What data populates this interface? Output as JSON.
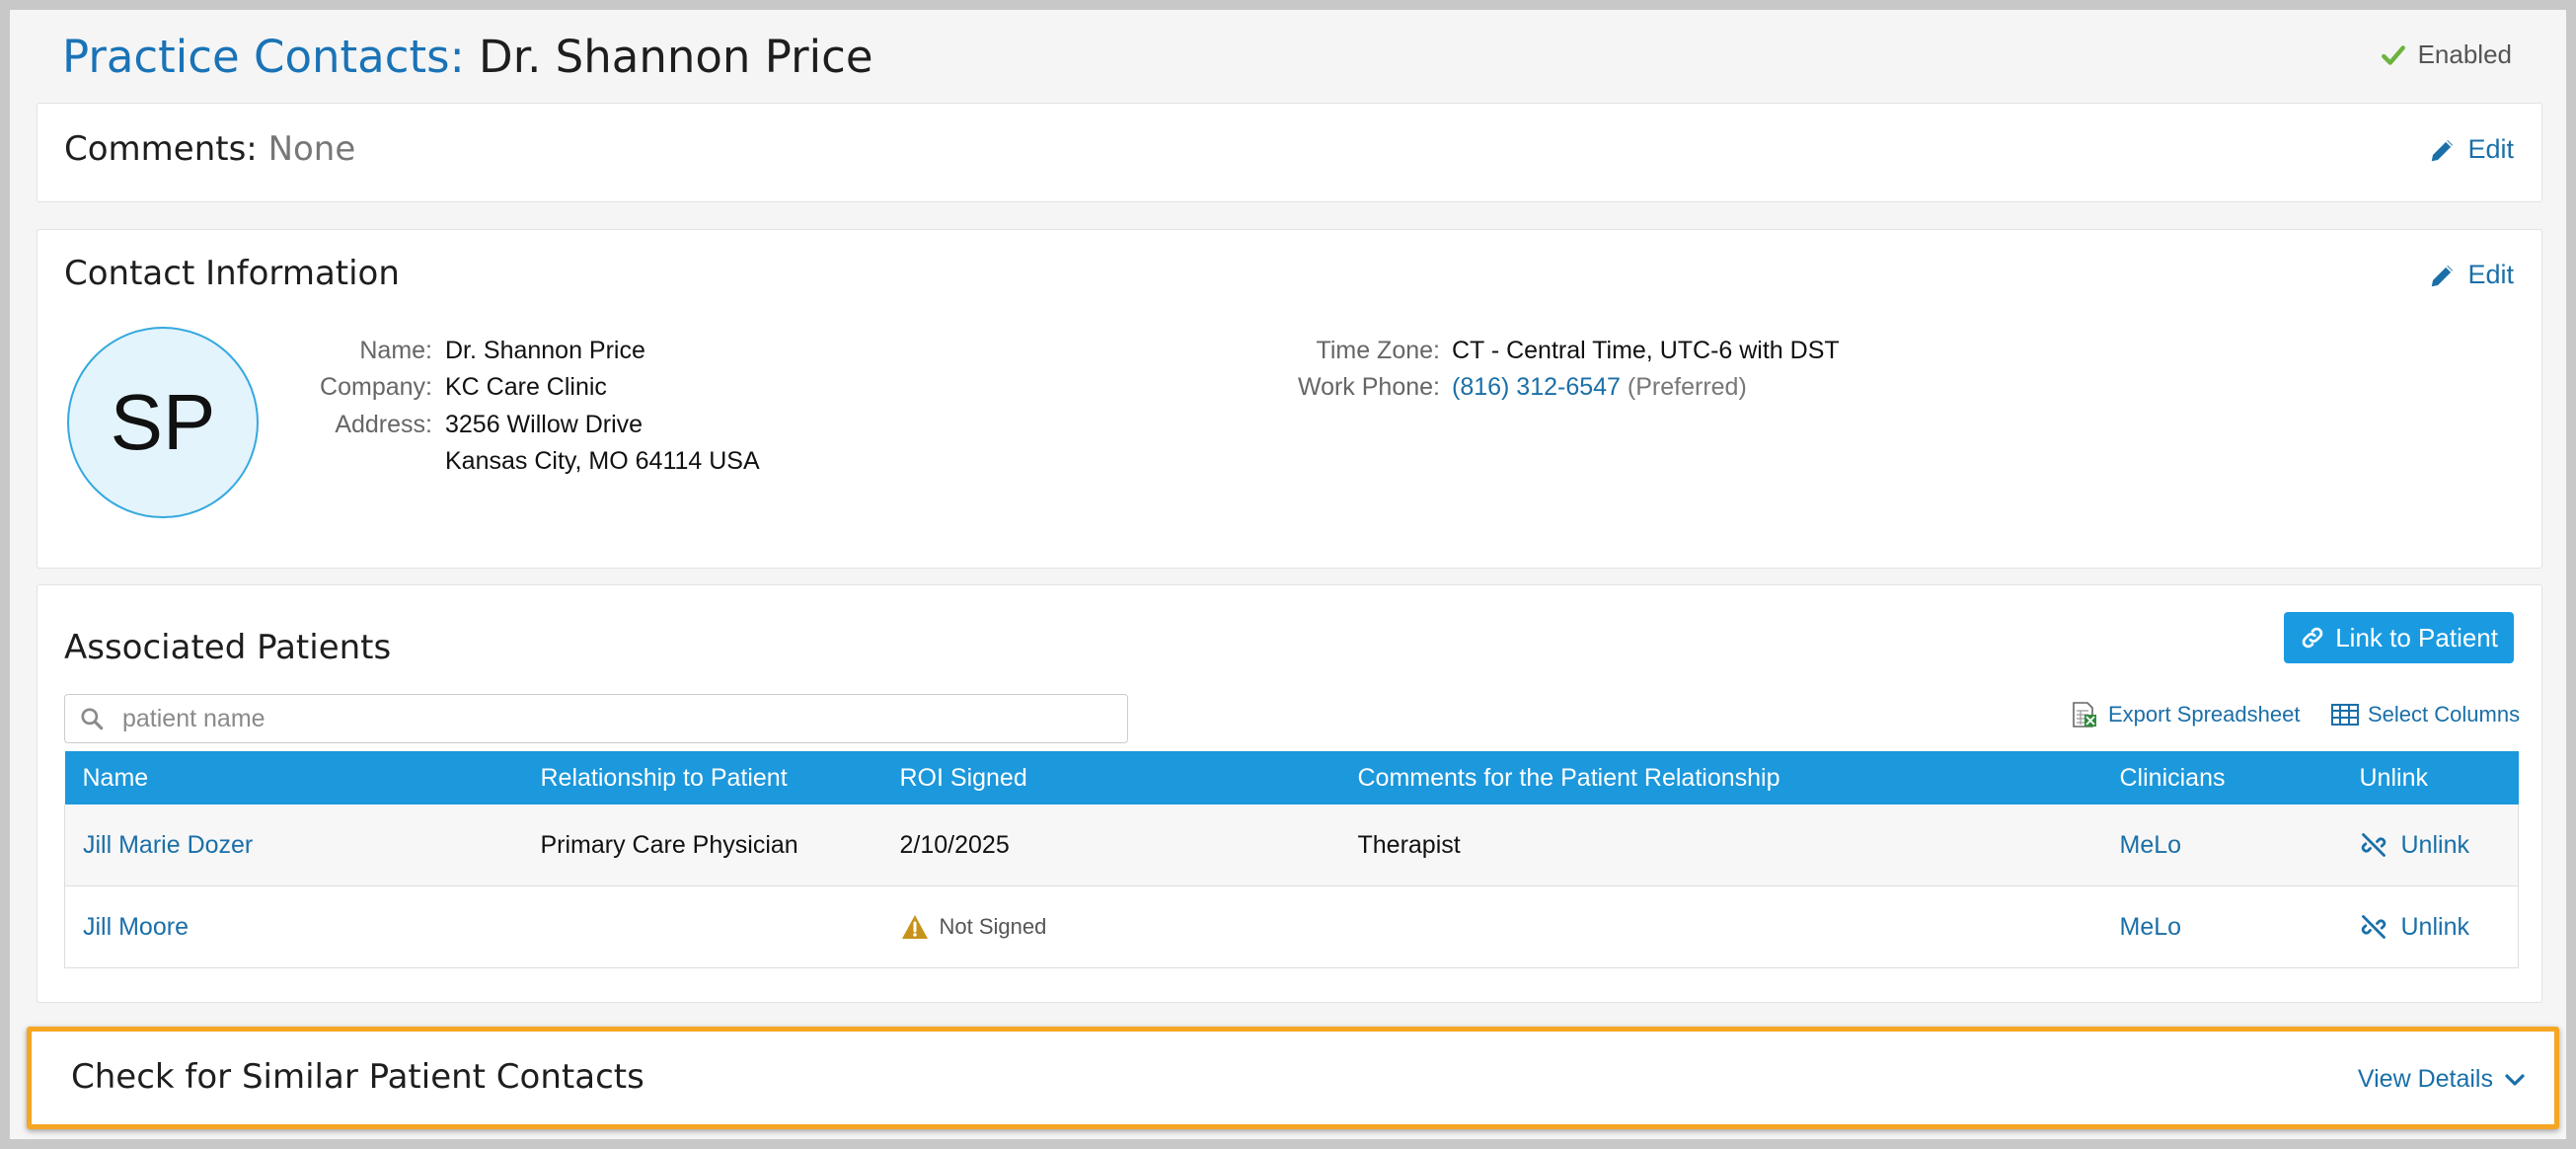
{
  "header": {
    "title_prefix": "Practice Contacts:",
    "title_name": "Dr. Shannon Price",
    "status": "Enabled"
  },
  "comments": {
    "label": "Comments:",
    "value": "None",
    "edit_label": "Edit"
  },
  "contact_info": {
    "title": "Contact Information",
    "edit_label": "Edit",
    "initials": "SP",
    "fields": {
      "name_label": "Name:",
      "name": "Dr. Shannon Price",
      "company_label": "Company:",
      "company": "KC Care Clinic",
      "address_label": "Address:",
      "address_line1": "3256 Willow Drive",
      "address_line2": "Kansas City, MO 64114 USA",
      "timezone_label": "Time Zone:",
      "timezone": "CT - Central Time, UTC-6 with DST",
      "work_phone_label": "Work Phone:",
      "work_phone": "(816) 312-6547",
      "work_phone_note": "(Preferred)"
    }
  },
  "patients": {
    "title": "Associated Patients",
    "link_button": "Link to Patient",
    "search_placeholder": "patient name",
    "export_label": "Export Spreadsheet",
    "select_columns_label": "Select Columns",
    "columns": [
      "Name",
      "Relationship to Patient",
      "ROI Signed",
      "Comments for the Patient Relationship",
      "Clinicians",
      "Unlink"
    ],
    "rows": [
      {
        "name": "Jill Marie Dozer",
        "relationship": "Primary Care Physician",
        "roi": "2/10/2025",
        "comments": "Therapist",
        "clinician": "MeLo",
        "unlink": "Unlink"
      },
      {
        "name": "Jill Moore",
        "relationship": "",
        "roi": "Not Signed",
        "comments": "",
        "clinician": "MeLo",
        "unlink": "Unlink"
      }
    ]
  },
  "similar": {
    "title": "Check for Similar Patient Contacts",
    "view_details": "View Details"
  },
  "colors": {
    "accent": "#1a73b6",
    "table_header": "#1c98dc",
    "button": "#1a9be1",
    "highlight": "#f5a623",
    "enabled_check": "#6cb33e",
    "warning": "#c7921a"
  },
  "icons": [
    "check-icon",
    "pencil-icon",
    "link-icon",
    "search-icon",
    "spreadsheet-icon",
    "table-icon",
    "unlink-icon",
    "warning-icon",
    "chevron-down-icon"
  ]
}
